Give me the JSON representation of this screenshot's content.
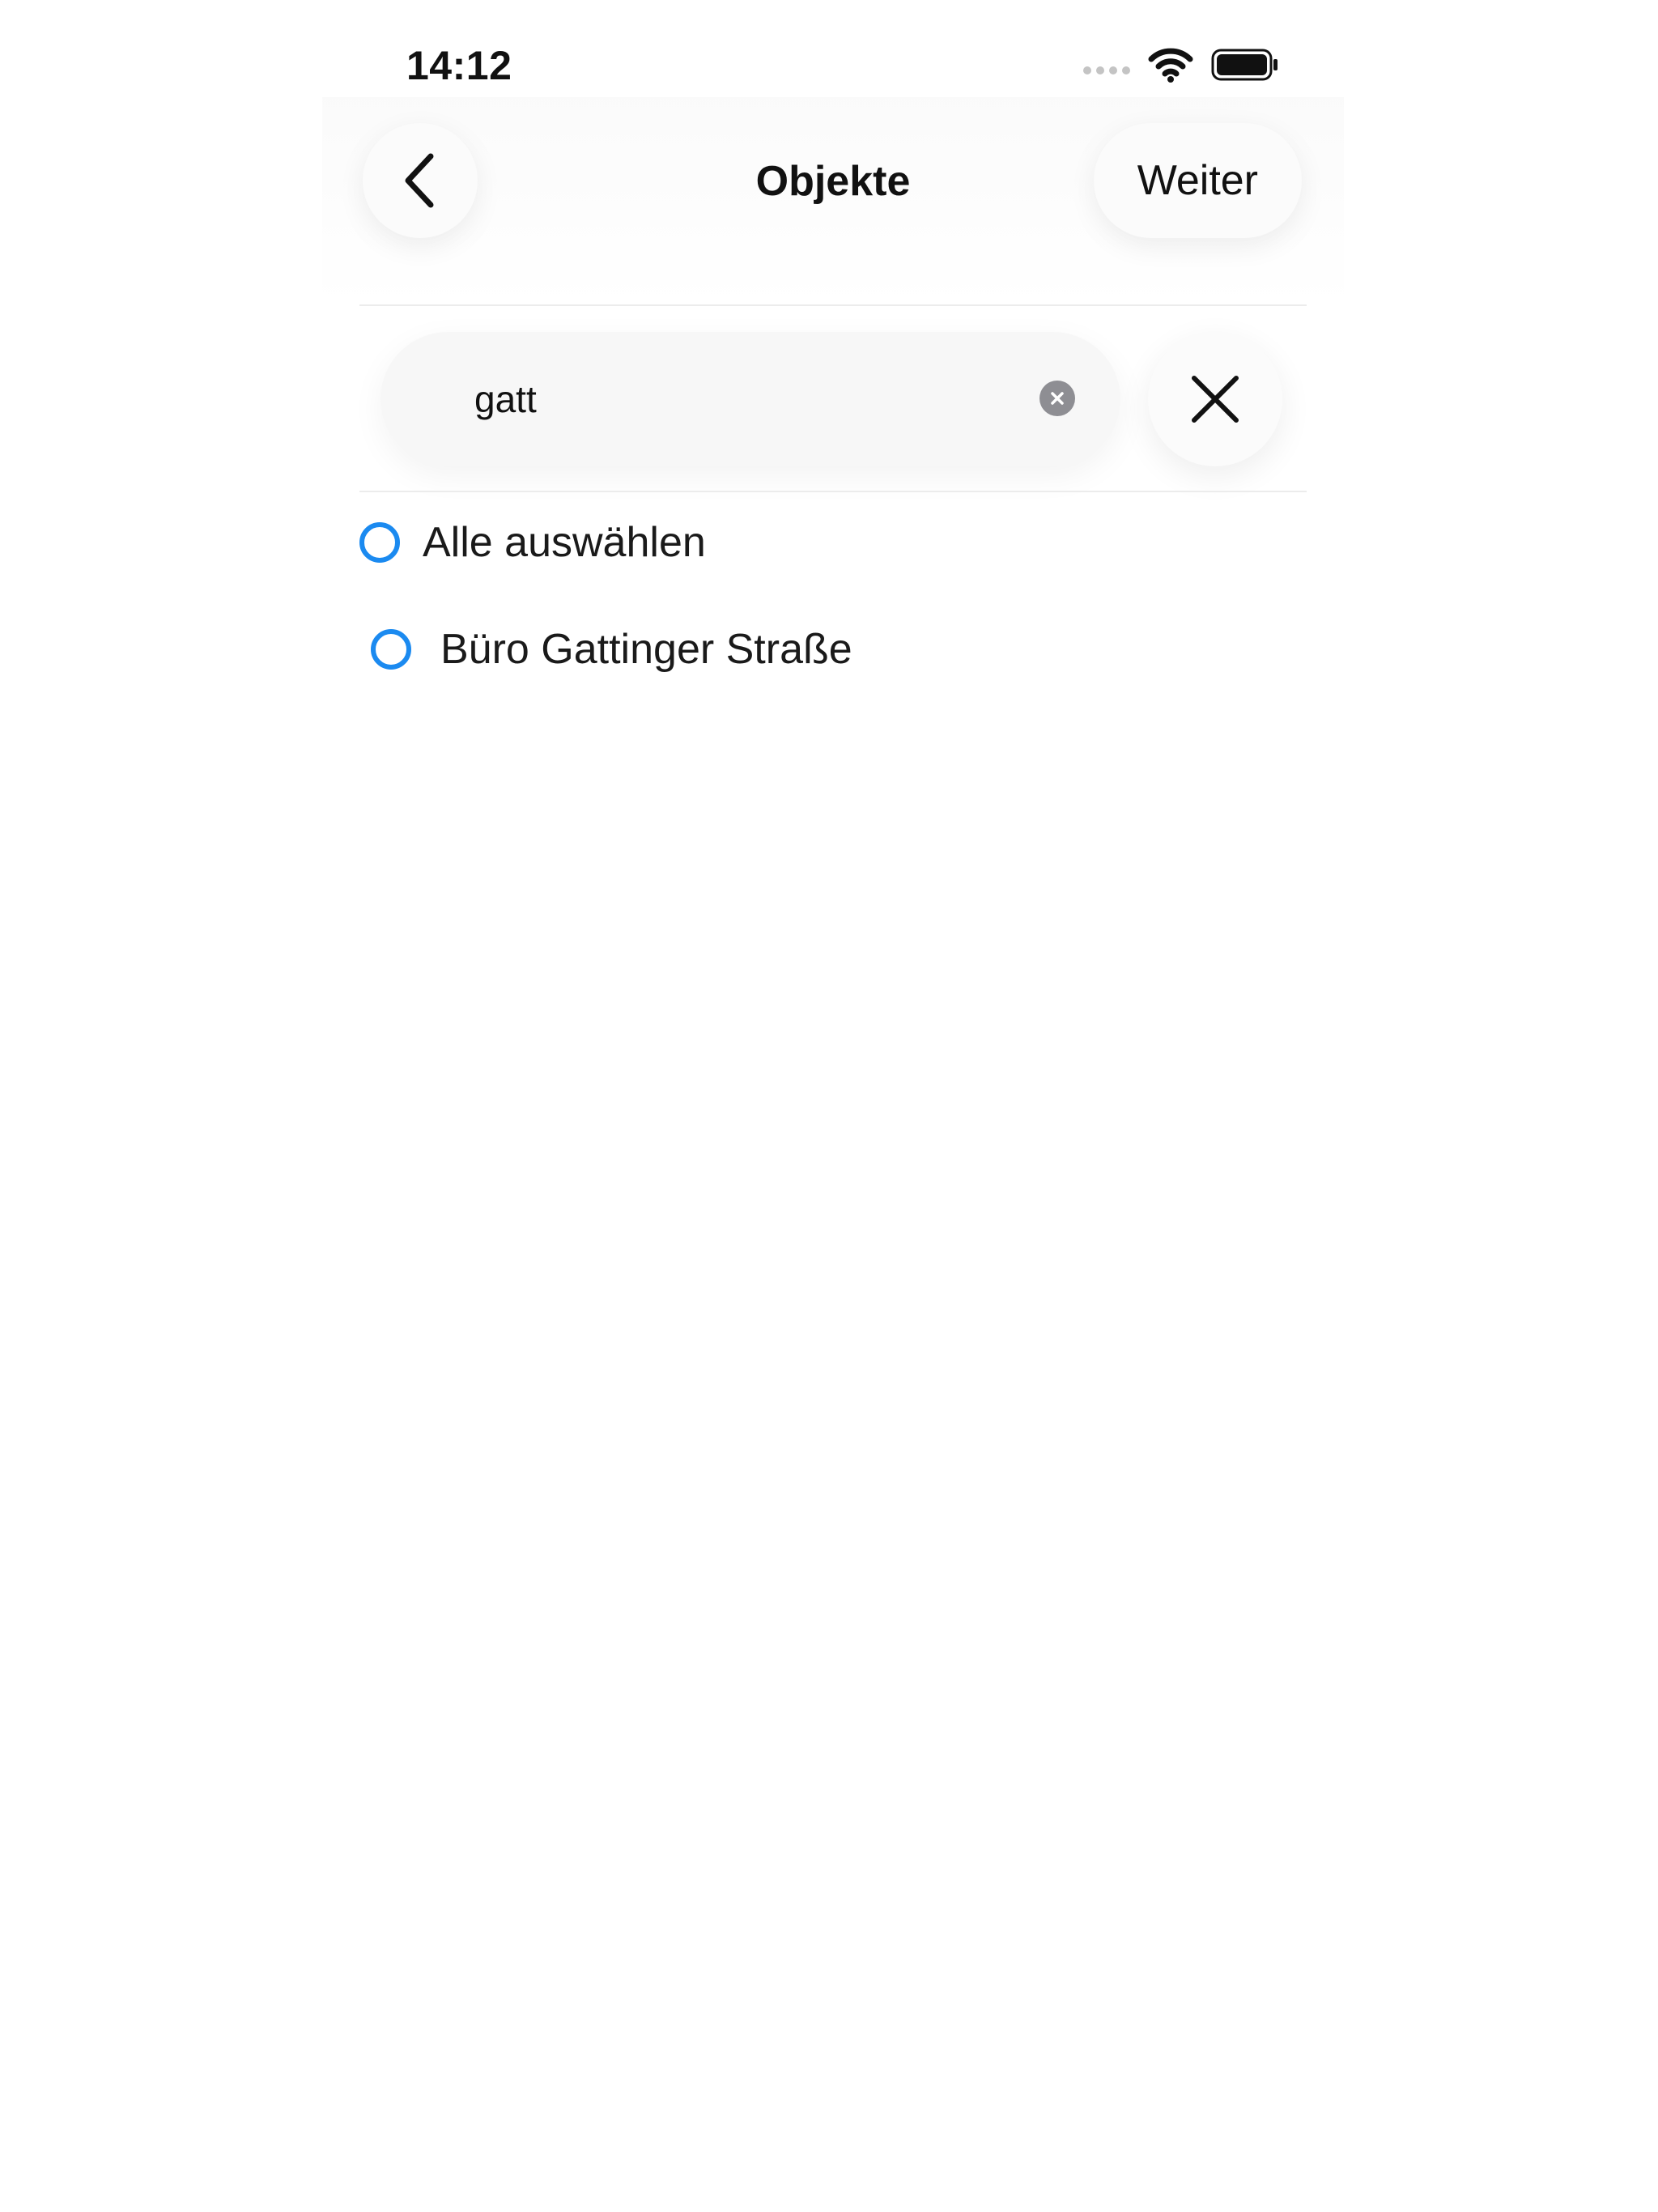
{
  "status_bar": {
    "time": "14:12"
  },
  "nav": {
    "title": "Objekte",
    "next_label": "Weiter"
  },
  "search": {
    "value": "gatt",
    "placeholder": ""
  },
  "list": {
    "select_all_label": "Alle auswählen",
    "items": [
      {
        "label": "Büro Gattinger Straße"
      }
    ]
  },
  "colors": {
    "accent": "#1b8af0",
    "background": "#ffffff"
  }
}
